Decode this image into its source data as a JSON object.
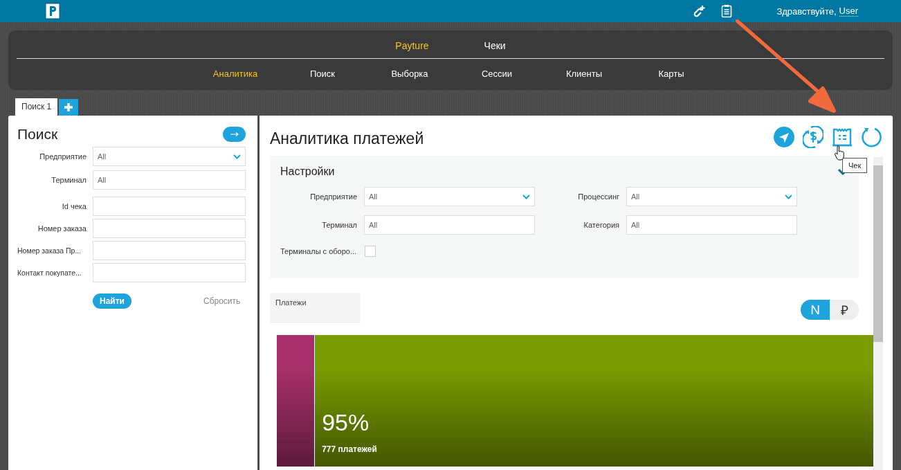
{
  "header": {
    "greeting": "Здравствуйте,",
    "user": "User"
  },
  "nav": {
    "sections": [
      {
        "label": "Payture",
        "selected": true
      },
      {
        "label": "Чеки",
        "selected": false
      }
    ],
    "items": [
      {
        "label": "Аналитика",
        "selected": true
      },
      {
        "label": "Поиск",
        "selected": false
      },
      {
        "label": "Выборка",
        "selected": false
      },
      {
        "label": "Сессии",
        "selected": false
      },
      {
        "label": "Клиенты",
        "selected": false
      },
      {
        "label": "Карты",
        "selected": false
      }
    ]
  },
  "tabs": [
    {
      "label": "Поиск 1",
      "selected": true
    }
  ],
  "search_panel": {
    "title": "Поиск",
    "fields": [
      {
        "label": "Предприятие",
        "value": "All",
        "kind": "select"
      },
      {
        "label": "Терминал",
        "value": "All",
        "kind": "text"
      },
      {
        "label": "Id чека",
        "kind": "text"
      },
      {
        "label": "Номер заказа",
        "kind": "text"
      },
      {
        "label": "Номер заказа Пр...",
        "kind": "text"
      },
      {
        "label": "Контакт покупате...",
        "kind": "text"
      }
    ],
    "submit": "Найти",
    "reset": "Сбросить"
  },
  "analytics": {
    "title": "Аналитика платежей",
    "tooltip": "Чек",
    "settings": {
      "title": "Настройки",
      "fields": [
        {
          "label": "Предприятие",
          "value": "All",
          "kind": "select"
        },
        {
          "label": "Процессинг",
          "value": "All",
          "kind": "select"
        },
        {
          "label": "Терминал",
          "value": "All",
          "kind": "text"
        },
        {
          "label": "Категория",
          "value": "All",
          "kind": "text"
        }
      ],
      "checkbox": {
        "label": "Терминалы с оборо...",
        "checked": false
      }
    },
    "payments_card": {
      "title": "Платежи"
    },
    "mode_toggle": [
      {
        "label": "N",
        "selected": true
      },
      {
        "label": "₽",
        "selected": false
      }
    ],
    "payments_bar": {
      "color": "#7a9c00",
      "percent": "95%",
      "caption": "777 платежей",
      "fill": {
        "level": 0.064,
        "color": "#a8306a"
      }
    }
  }
}
